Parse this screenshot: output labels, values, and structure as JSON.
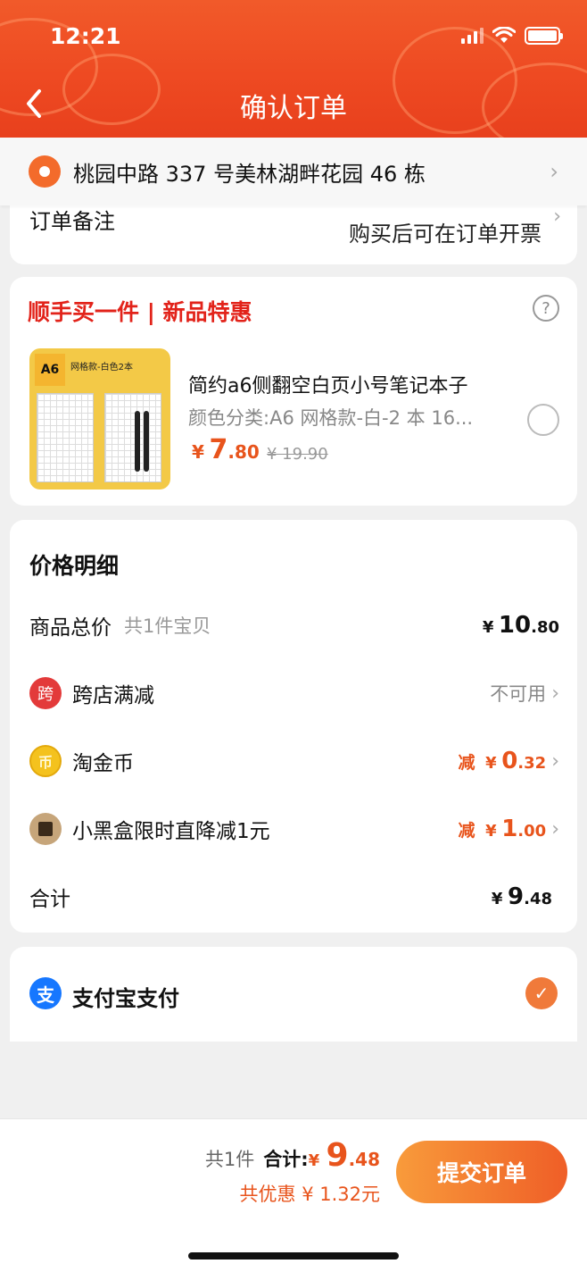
{
  "status": {
    "time": "12:21"
  },
  "header": {
    "title": "确认订单"
  },
  "address": {
    "text": "桃园中路 337 号美林湖畔花园 46 栋"
  },
  "remark": {
    "label": "订单备注",
    "value": "购买后可在订单开票"
  },
  "promo": {
    "title": "顺手买一件 | 新品特惠",
    "product": {
      "name": "简约a6侧翻空白页小号笔记本子",
      "spec": "颜色分类:A6 网格款-白-2 本 16...",
      "price_symbol": "¥",
      "price_int": "7",
      "price_dec": ".80",
      "original_price": "¥ 19.90",
      "thumb_label": "A6",
      "thumb_text": "网格款-白色2本",
      "selected": false
    }
  },
  "price_detail": {
    "title": "价格明细",
    "goods_total": {
      "label": "商品总价",
      "sub": "共1件宝贝",
      "symbol": "¥",
      "int": "10",
      "dec": ".80"
    },
    "cross_store": {
      "icon_text": "跨",
      "label": "跨店满减",
      "value": "不可用"
    },
    "taojinbi": {
      "icon_text": "币",
      "label": "淘金币",
      "minus": "减",
      "symbol": "¥",
      "int": "0",
      "dec": ".32"
    },
    "black_box": {
      "label": "小黑盒限时直降减1元",
      "minus": "减",
      "symbol": "¥",
      "int": "1",
      "dec": ".00"
    },
    "total": {
      "label": "合计",
      "symbol": "¥",
      "int": "9",
      "dec": ".48"
    }
  },
  "payment": {
    "icon_text": "支",
    "label": "支付宝支付",
    "selected": true
  },
  "footer": {
    "count": "共1件",
    "total_label": "合计:",
    "symbol": "¥",
    "int": "9",
    "dec": ".48",
    "saving": "共优惠 ¥ 1.32元",
    "submit_label": "提交订单"
  },
  "colors": {
    "brand": "#ee4a22",
    "price": "#e8541c",
    "alipay": "#1677ff"
  }
}
